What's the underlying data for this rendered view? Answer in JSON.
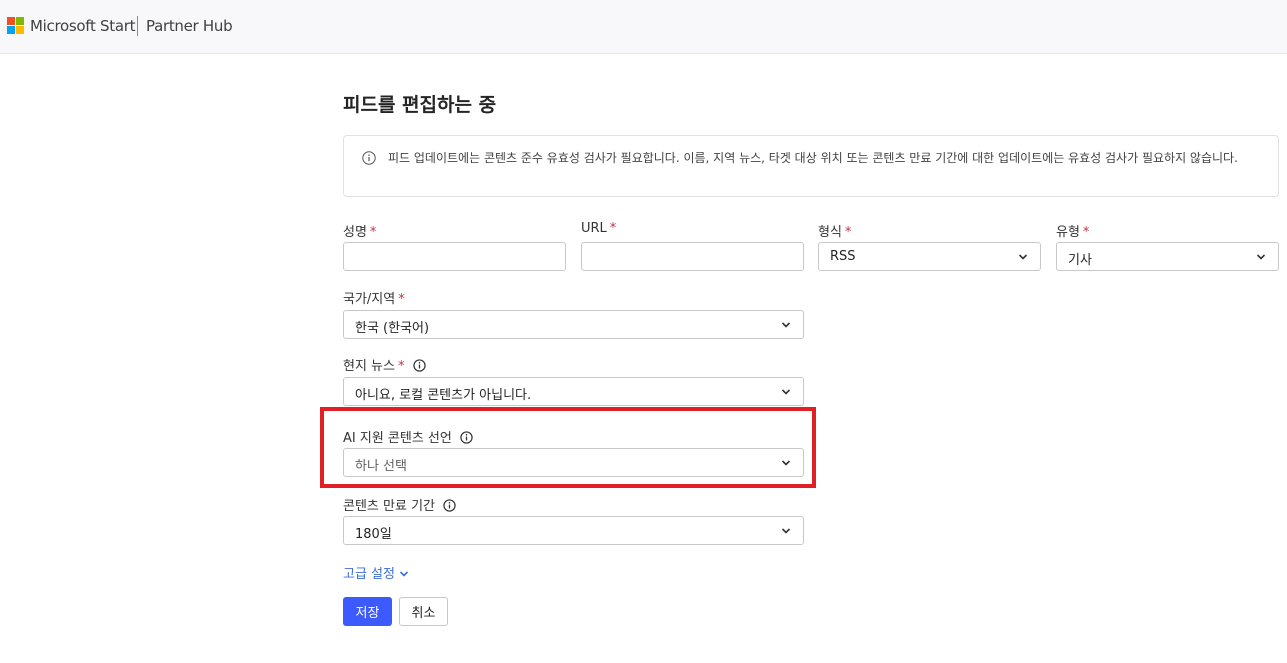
{
  "header": {
    "brand": "Microsoft Start",
    "hub": "Partner Hub"
  },
  "page": {
    "title": "피드를 편집하는 중",
    "notice": "피드 업데이트에는 콘텐츠 준수 유효성 검사가 필요합니다. 이름, 지역 뉴스, 타겟 대상 위치 또는 콘텐츠 만료 기간에 대한 업데이트에는 유효성 검사가 필요하지 않습니다."
  },
  "form": {
    "name": {
      "label": "성명",
      "required": "*",
      "value": ""
    },
    "url": {
      "label": "URL",
      "required": "*",
      "value": ""
    },
    "format": {
      "label": "형식",
      "required": "*",
      "value": "RSS"
    },
    "type": {
      "label": "유형",
      "required": "*",
      "value": "기사"
    },
    "region": {
      "label": "국가/지역",
      "required": "*",
      "value": "한국 (한국어)"
    },
    "local_news": {
      "label": "현지 뉴스",
      "required": "*",
      "value": "아니요, 로컬 콘텐츠가 아닙니다."
    },
    "ai_content": {
      "label": "AI 지원 콘텐츠 선언",
      "placeholder": "하나 선택"
    },
    "expiry": {
      "label": "콘텐츠 만료 기간",
      "value": "180일"
    },
    "advanced": "고급 설정",
    "save": "저장",
    "cancel": "취소"
  },
  "colors": {
    "primary": "#3d5afe",
    "link": "#3d6fd9",
    "required": "#c4314b",
    "highlight": "#e01f26"
  }
}
